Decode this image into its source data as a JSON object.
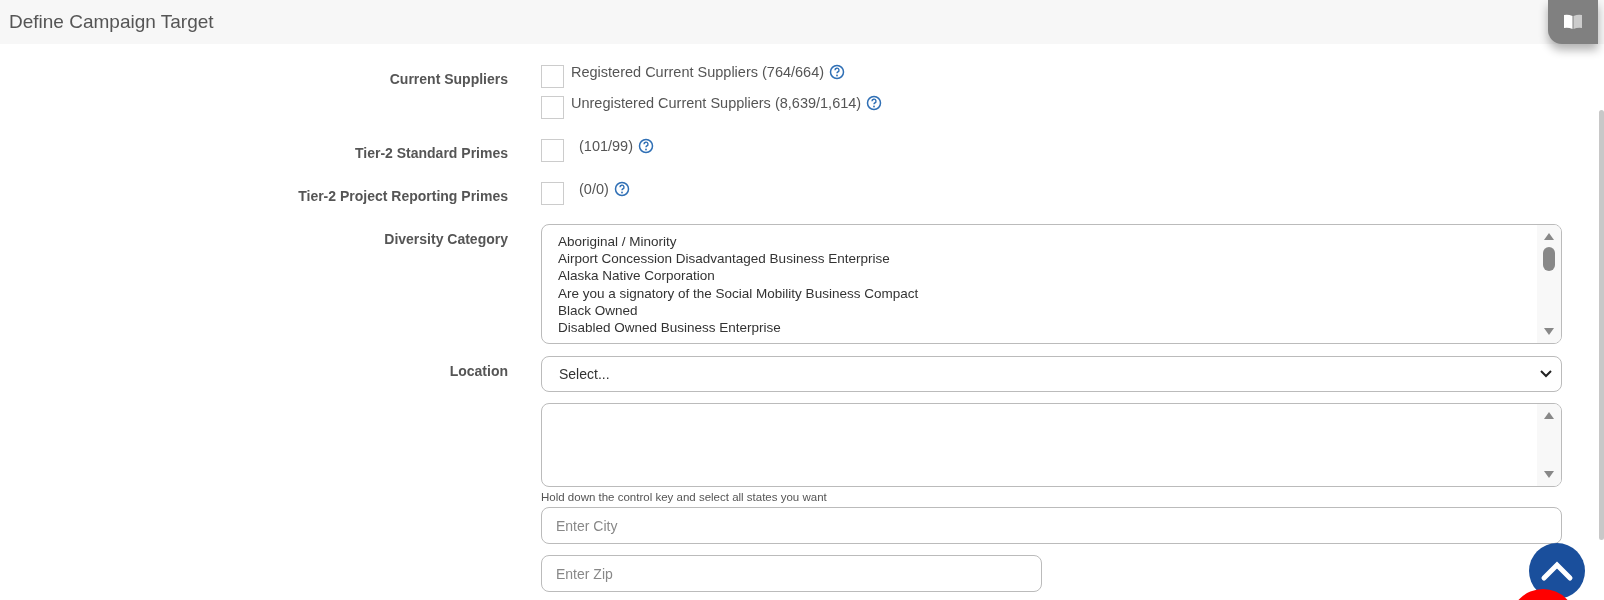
{
  "header": {
    "title": "Define Campaign Target"
  },
  "rows": [
    {
      "kind": "checkboxes",
      "label": "Current Suppliers",
      "options": [
        {
          "label": "Registered Current Suppliers (764/664)",
          "checked": false
        },
        {
          "label": "Unregistered Current Suppliers (8,639/1,614)",
          "checked": false
        }
      ]
    },
    {
      "kind": "checkboxes",
      "label": "Tier-2 Standard Primes",
      "options": [
        {
          "label": "(101/99)",
          "checked": false
        }
      ]
    },
    {
      "kind": "checkboxes",
      "label": "Tier-2 Project Reporting Primes",
      "options": [
        {
          "label": "(0/0)",
          "checked": false
        }
      ]
    },
    {
      "kind": "listbox",
      "label": "Diversity Category",
      "options": [
        "Aboriginal / Minority",
        "Airport Concession Disadvantaged Business Enterprise",
        "Alaska Native Corporation",
        "Are you a signatory of the Social Mobility Business Compact",
        "Black Owned",
        "Disabled Owned Business Enterprise"
      ]
    },
    {
      "kind": "location",
      "label": "Location",
      "select": {
        "placeholder": "Select..."
      },
      "hint": "Hold down the control key and select all states you want",
      "city": {
        "placeholder": "Enter City"
      },
      "zip": {
        "placeholder": "Enter Zip"
      }
    }
  ]
}
